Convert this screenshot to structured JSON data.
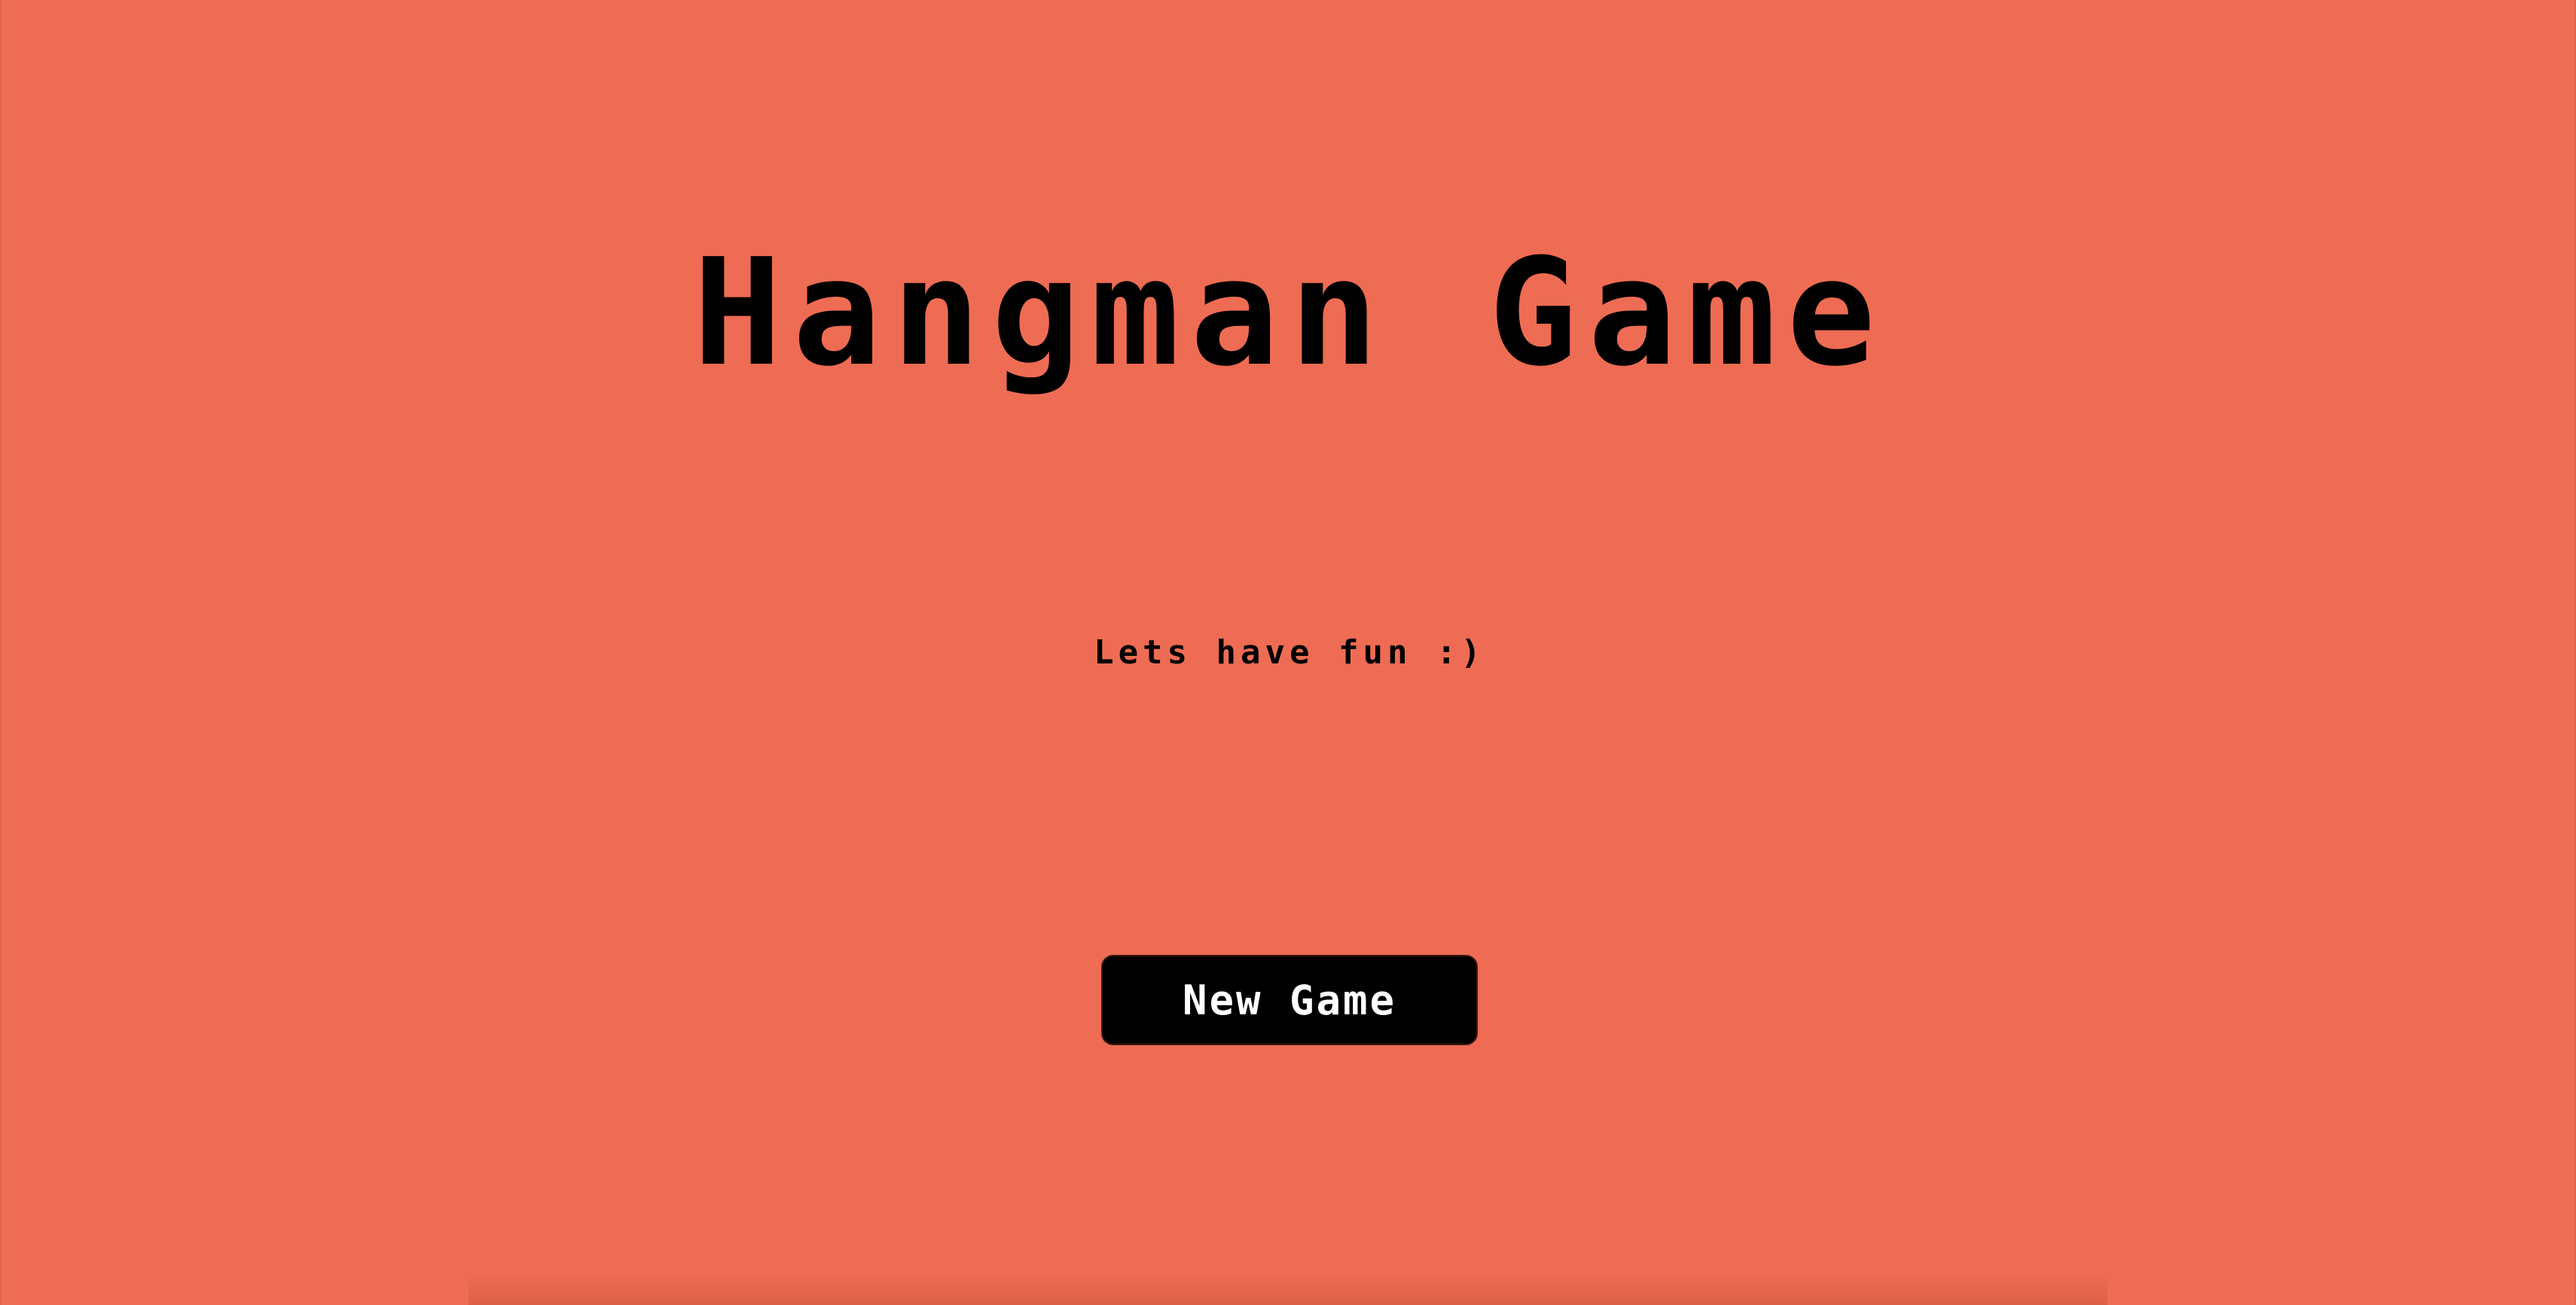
{
  "game": {
    "title": "Hangman Game",
    "subtitle": "Lets have fun :)",
    "new_game_label": "New Game"
  },
  "colors": {
    "background": "#ee6c53",
    "text": "#000000",
    "button_background": "#000000",
    "button_text": "#ffffff"
  }
}
